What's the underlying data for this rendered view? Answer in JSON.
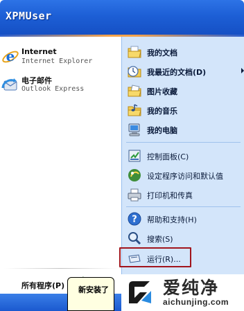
{
  "header": {
    "username": "XPMUser"
  },
  "pinned": [
    {
      "name": "Internet",
      "sub": "Internet Explorer",
      "icon": "ie-icon"
    },
    {
      "name": "电子邮件",
      "sub": "Outlook Express",
      "icon": "outlook-icon"
    }
  ],
  "right_menu": [
    {
      "label": "我的文档",
      "icon": "my-documents-icon",
      "bold": true
    },
    {
      "label": "我最近的文档(D)",
      "icon": "recent-documents-icon",
      "bold": true,
      "submenu": true
    },
    {
      "label": "图片收藏",
      "icon": "my-pictures-icon",
      "bold": true
    },
    {
      "label": "我的音乐",
      "icon": "my-music-icon",
      "bold": true
    },
    {
      "label": "我的电脑",
      "icon": "my-computer-icon",
      "bold": true
    },
    {
      "label": "控制面板(C)",
      "icon": "control-panel-icon"
    },
    {
      "label": "设定程序访问和默认值",
      "icon": "program-access-icon"
    },
    {
      "label": "打印机和传真",
      "icon": "printers-icon"
    },
    {
      "label": "帮助和支持(H)",
      "icon": "help-icon"
    },
    {
      "label": "搜索(S)",
      "icon": "search-icon"
    },
    {
      "label": "运行(R)...",
      "icon": "run-icon"
    }
  ],
  "footer": {
    "all_programs": "所有程序(P)",
    "tooltip": "新安装了"
  },
  "watermark": {
    "cn": "爱纯净",
    "en": "aichunjing.com"
  },
  "colors": {
    "header_blue": "#1d5fd6",
    "right_panel": "#d3e5fa",
    "highlight_border": "#a1141c",
    "tooltip_bg": "#ffffe1"
  }
}
